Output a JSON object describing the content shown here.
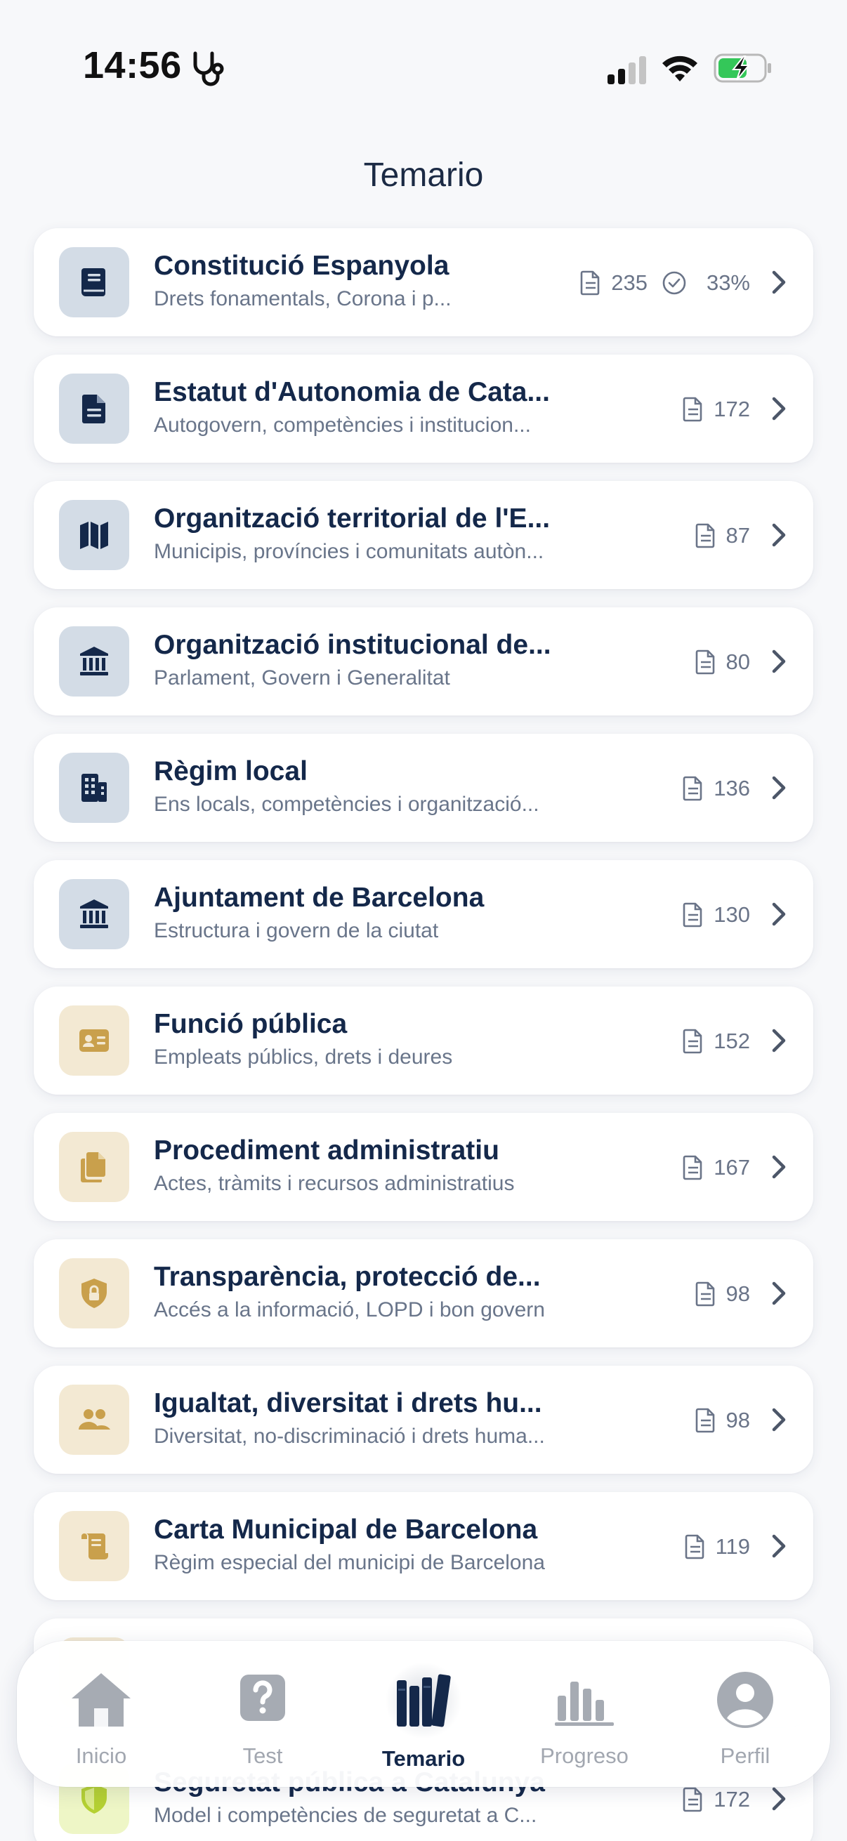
{
  "status_bar": {
    "time": "14:56"
  },
  "header": {
    "title": "Temario"
  },
  "topics": [
    {
      "title": "Constitució Espanyola",
      "subtitle": "Drets fonamentals, Corona i p...",
      "count": "235",
      "progress": "33%",
      "icon": "book-icon",
      "tone": "blue"
    },
    {
      "title": "Estatut d'Autonomia de Cata...",
      "subtitle": "Autogovern, competències i institucion...",
      "count": "172",
      "icon": "document-icon",
      "tone": "blue"
    },
    {
      "title": "Organització territorial de l'E...",
      "subtitle": "Municipis, províncies i comunitats autòn...",
      "count": "87",
      "icon": "map-icon",
      "tone": "blue"
    },
    {
      "title": "Organització institucional de...",
      "subtitle": "Parlament, Govern i Generalitat",
      "count": "80",
      "icon": "institution-icon",
      "tone": "blue"
    },
    {
      "title": "Règim local",
      "subtitle": "Ens locals, competències i organització...",
      "count": "136",
      "icon": "building-icon",
      "tone": "blue"
    },
    {
      "title": "Ajuntament de Barcelona",
      "subtitle": "Estructura i govern de la ciutat",
      "count": "130",
      "icon": "institution-icon",
      "tone": "blue"
    },
    {
      "title": "Funció pública",
      "subtitle": "Empleats públics, drets i deures",
      "count": "152",
      "icon": "id-card-icon",
      "tone": "tan"
    },
    {
      "title": "Procediment administratiu",
      "subtitle": "Actes, tràmits i recursos administratius",
      "count": "167",
      "icon": "files-icon",
      "tone": "tan"
    },
    {
      "title": "Transparència, protecció de...",
      "subtitle": "Accés a la informació, LOPD i bon govern",
      "count": "98",
      "icon": "shield-lock-icon",
      "tone": "tan"
    },
    {
      "title": "Igualtat, diversitat i drets hu...",
      "subtitle": "Diversitat, no-discriminació i drets huma...",
      "count": "98",
      "icon": "people-icon",
      "tone": "tan"
    },
    {
      "title": "Carta Municipal de Barcelona",
      "subtitle": "Règim especial del municipi de Barcelona",
      "count": "119",
      "icon": "scroll-icon",
      "tone": "tan"
    },
    {
      "title": "",
      "subtitle": "",
      "count": "",
      "icon": "",
      "tone": "tan"
    },
    {
      "title": "Seguretat pública a Catalunya",
      "subtitle": "Model i competències de seguretat a C...",
      "count": "172",
      "icon": "shield-icon",
      "tone": "lime"
    }
  ],
  "nav": [
    {
      "label": "Inicio",
      "icon": "home-icon",
      "active": false
    },
    {
      "label": "Test",
      "icon": "question-icon",
      "active": false
    },
    {
      "label": "Temario",
      "icon": "books-icon",
      "active": true
    },
    {
      "label": "Progreso",
      "icon": "bar-chart-icon",
      "active": false
    },
    {
      "label": "Perfil",
      "icon": "user-icon",
      "active": false
    }
  ],
  "colors": {
    "primary": "#14284a",
    "inactive": "#a2a7b0",
    "blue_tint": "#d3dce6",
    "tan_tint": "#f3e9d3",
    "tan_icon": "#c9a04c",
    "battery_green": "#34c759"
  }
}
